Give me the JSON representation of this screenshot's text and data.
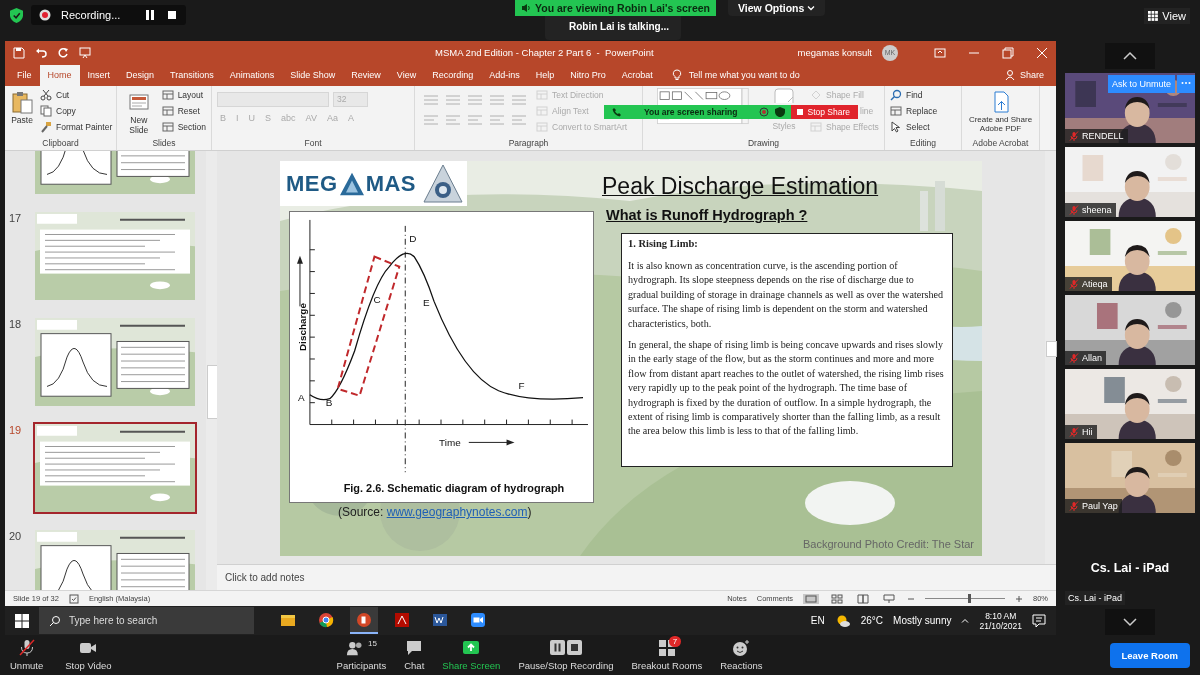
{
  "zoom_top": {
    "recording": "Recording...",
    "banner": "You are viewing Robin Lai's screen",
    "talking": "Robin Lai is talking...",
    "view_options": "View Options",
    "view": "View"
  },
  "window": {
    "title": "MSMA 2nd Edition - Chapter 2 Part 6  -  PowerPoint",
    "user": "megamas konsult",
    "initials": "MK"
  },
  "tabs": [
    {
      "label": "File",
      "selected": false
    },
    {
      "label": "Home",
      "selected": true
    },
    {
      "label": "Insert",
      "selected": false
    },
    {
      "label": "Design",
      "selected": false
    },
    {
      "label": "Transitions",
      "selected": false
    },
    {
      "label": "Animations",
      "selected": false
    },
    {
      "label": "Slide Show",
      "selected": false
    },
    {
      "label": "Review",
      "selected": false
    },
    {
      "label": "View",
      "selected": false
    },
    {
      "label": "Recording",
      "selected": false
    },
    {
      "label": "Add-ins",
      "selected": false
    },
    {
      "label": "Help",
      "selected": false
    },
    {
      "label": "Nitro Pro",
      "selected": false
    },
    {
      "label": "Acrobat",
      "selected": false
    }
  ],
  "tell_me": "Tell me what you want to do",
  "share": "Share",
  "ribbon": [
    {
      "label": "Clipboard",
      "items": [
        {
          "kind": "large",
          "label": "Paste",
          "disabled": false
        },
        {
          "kind": "small",
          "label": "Cut",
          "disabled": false
        },
        {
          "kind": "small",
          "label": "Copy",
          "disabled": false
        },
        {
          "kind": "small",
          "label": "Format Painter",
          "disabled": false
        }
      ]
    },
    {
      "label": "Slides",
      "items": [
        {
          "kind": "large",
          "label": "New Slide",
          "disabled": false
        },
        {
          "kind": "small",
          "label": "Layout",
          "disabled": false
        },
        {
          "kind": "small",
          "label": "Reset",
          "disabled": false
        },
        {
          "kind": "small",
          "label": "Section",
          "disabled": false
        }
      ]
    },
    {
      "label": "Font",
      "items": [
        {
          "kind": "field",
          "label": "32",
          "disabled": true
        },
        {
          "kind": "glyph",
          "label": "B",
          "disabled": true
        },
        {
          "kind": "glyph",
          "label": "I",
          "disabled": true
        },
        {
          "kind": "glyph",
          "label": "U",
          "disabled": true
        },
        {
          "kind": "glyph",
          "label": "S",
          "disabled": true
        },
        {
          "kind": "glyph",
          "label": "abc",
          "disabled": true
        },
        {
          "kind": "glyph",
          "label": "AV",
          "disabled": true
        },
        {
          "kind": "glyph",
          "label": "Aa",
          "disabled": true
        },
        {
          "kind": "glyph",
          "label": "A",
          "disabled": true
        }
      ]
    },
    {
      "label": "Paragraph",
      "items": [
        {
          "kind": "tools",
          "disabled": true
        },
        {
          "kind": "small",
          "label": "Text Direction",
          "disabled": true
        },
        {
          "kind": "small",
          "label": "Align Text",
          "disabled": true
        },
        {
          "kind": "small",
          "label": "Convert to SmartArt",
          "disabled": true
        }
      ]
    },
    {
      "label": "Drawing",
      "items": [
        {
          "kind": "shapes"
        },
        {
          "kind": "styles",
          "label": "Styles",
          "disabled": true
        },
        {
          "kind": "small",
          "label": "Shape Fill",
          "disabled": true
        },
        {
          "kind": "partial",
          "label": "line",
          "disabled": true
        },
        {
          "kind": "small",
          "label": "Shape Effects",
          "disabled": true
        }
      ]
    },
    {
      "label": "Editing",
      "items": [
        {
          "kind": "small",
          "label": "Find",
          "disabled": false
        },
        {
          "kind": "small",
          "label": "Replace",
          "disabled": false
        },
        {
          "kind": "small",
          "label": "Select",
          "disabled": false
        }
      ]
    },
    {
      "label": "Adobe Acrobat",
      "items": [
        {
          "kind": "large",
          "label": "Create and Share Adobe PDF",
          "disabled": false
        }
      ]
    }
  ],
  "sharing": {
    "label": "You are screen sharing",
    "stop": "Stop Share"
  },
  "thumbnails": [
    {
      "selected": false
    },
    {
      "number": "17",
      "selected": false
    },
    {
      "number": "18",
      "selected": false
    },
    {
      "number": "19",
      "selected": true
    },
    {
      "number": "20",
      "selected": false
    }
  ],
  "slide": {
    "logo_left": "MEG",
    "logo_right": "MAS",
    "title": "Peak Discharge Estimation",
    "subtitle": "What is Runoff Hydrograph ?",
    "figure": {
      "ylabel": "Discharge",
      "xlabel": "Time",
      "points": [
        "A",
        "B",
        "C",
        "D",
        "E",
        "F"
      ],
      "caption": "Fig. 2.6. Schematic diagram of hydrograph"
    },
    "source": {
      "prefix": "(Source: ",
      "link": "www.geographynotes.com",
      "suffix": ")"
    },
    "box_heading": "1. Rising Limb:",
    "paragraphs": [
      "It is also known as concentration curve, is the ascending portion of hydrograph. Its slope steepness depends on the rise of discharge due to gradual building of storage in drainage channels as well as over the watershed surface. The shape of rising limb is dependent on the storm and watershed characteristics, both.",
      "In general, the shape of rising limb is being concave upwards and rises slowly in the early stage of the flow, but as the storm continues and more and more flow from distant apart reaches to the outlet of watershed, the rising limb rises very rapidly up to the peak point of the hydrograph. The time base of hydrograph is fixed by the duration of outflow. In a simple hydrograph, the extent of rising limb is comparatively shorter than the falling limb, as a result the area below this limb is less to that of the falling limb."
    ],
    "credit": "Background Photo Credit: The Star"
  },
  "notes": "Click to add notes",
  "status_bar": {
    "slide": "Slide 19 of 32",
    "language": "English (Malaysia)",
    "notes": "Notes",
    "comments": "Comments",
    "zoom": "80%",
    "zoom_slider": {
      "level": 0.55
    }
  },
  "taskbar": {
    "search": "Type here to search",
    "apps": [
      {
        "kind": "explorer",
        "selected": false
      },
      {
        "kind": "chrome",
        "selected": false
      },
      {
        "kind": "powerpoint",
        "selected": true
      },
      {
        "kind": "acrobat",
        "selected": false
      },
      {
        "kind": "word",
        "selected": false
      },
      {
        "kind": "zoom",
        "selected": false
      }
    ],
    "lang": "EN",
    "temp": "26°C",
    "weather": "Mostly sunny",
    "time": "8:10 AM",
    "date": "21/10/2021"
  },
  "participants": {
    "ask_unmute": "Ask to Unmute",
    "tiles": [
      {
        "name": "RENDELL",
        "muted": true
      },
      {
        "name": "sheena",
        "muted": true
      },
      {
        "name": "Atieqa",
        "muted": true
      },
      {
        "name": "Allan",
        "muted": true
      },
      {
        "name": "Hii",
        "muted": true
      },
      {
        "name": "Paul Yap",
        "muted": true
      }
    ],
    "speaker_big": "Cs. Lai - iPad",
    "speaker_small": "Cs. Lai - iPad"
  },
  "meeting_controls": [
    {
      "kind": "mic",
      "label": "Unmute"
    },
    {
      "kind": "video",
      "label": "Stop Video"
    },
    {
      "kind": "participants",
      "label": "Participants",
      "count": "15"
    },
    {
      "kind": "chat",
      "label": "Chat"
    },
    {
      "kind": "share",
      "label": "Share Screen"
    },
    {
      "kind": "record",
      "label": "Pause/Stop Recording"
    },
    {
      "kind": "breakout",
      "label": "Breakout Rooms",
      "badge": "7"
    },
    {
      "kind": "reactions",
      "label": "Reactions"
    }
  ],
  "leave": "Leave Room"
}
